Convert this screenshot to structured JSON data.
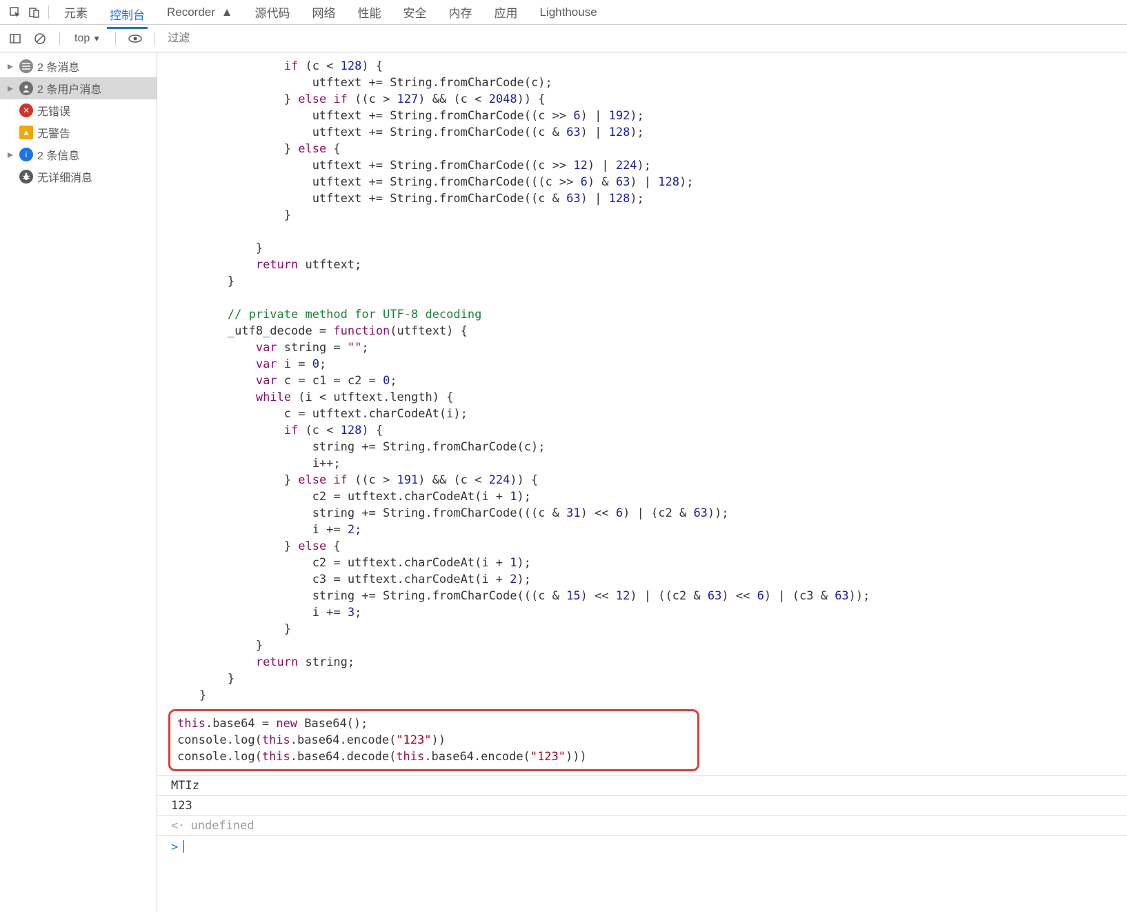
{
  "toolbar": {
    "tabs": {
      "elements": "元素",
      "console": "控制台",
      "recorder": "Recorder",
      "sources": "源代码",
      "network": "网络",
      "performance": "性能",
      "security": "安全",
      "memory": "内存",
      "application": "应用",
      "lighthouse": "Lighthouse"
    }
  },
  "sub_toolbar": {
    "context": "top",
    "filter_placeholder": "过滤"
  },
  "sidebar": {
    "messages": "2 条消息",
    "user_messages": "2 条用户消息",
    "no_errors": "无错误",
    "no_warnings": "无警告",
    "info": "2 条信息",
    "no_verbose": "无详细消息"
  },
  "code": {
    "line1": "if (c < 128) {",
    "line2": "utftext += String.fromCharCode(c);",
    "line3": "} else if ((c > 127) && (c < 2048)) {",
    "line4": "utftext += String.fromCharCode((c >> 6) | 192);",
    "line5": "utftext += String.fromCharCode((c & 63) | 128);",
    "line6": "} else {",
    "line7": "utftext += String.fromCharCode((c >> 12) | 224);",
    "line8": "utftext += String.fromCharCode(((c >> 6) & 63) | 128);",
    "line9": "utftext += String.fromCharCode((c & 63) | 128);",
    "line10": "}",
    "line11": "}",
    "line12": "return utftext;",
    "line13": "}",
    "line14": "// private method for UTF-8 decoding",
    "line15": "_utf8_decode = function(utftext) {",
    "line16": "var string = \"\";",
    "line17": "var i = 0;",
    "line18": "var c = c1 = c2 = 0;",
    "line19": "while (i < utftext.length) {",
    "line20": "c = utftext.charCodeAt(i);",
    "line21": "if (c < 128) {",
    "line22": "string += String.fromCharCode(c);",
    "line23": "i++;",
    "line24": "} else if ((c > 191) && (c < 224)) {",
    "line25": "c2 = utftext.charCodeAt(i + 1);",
    "line26": "string += String.fromCharCode(((c & 31) << 6) | (c2 & 63));",
    "line27": "i += 2;",
    "line28": "} else {",
    "line29": "c2 = utftext.charCodeAt(i + 1);",
    "line30": "c3 = utftext.charCodeAt(i + 2);",
    "line31": "string += String.fromCharCode(((c & 15) << 12) | ((c2 & 63) << 6) | (c3 & 63));",
    "line32": "i += 3;",
    "line33": "}",
    "line34": "}",
    "line35": "return string;",
    "line36": "}",
    "line37": "}"
  },
  "highlight": {
    "l1": "this.base64 = new Base64();",
    "l2": "console.log(this.base64.encode(\"123\"))",
    "l3": "console.log(this.base64.decode(this.base64.encode(\"123\")))"
  },
  "output": {
    "o1": "MTIz",
    "o2": "123",
    "undef": "undefined"
  }
}
